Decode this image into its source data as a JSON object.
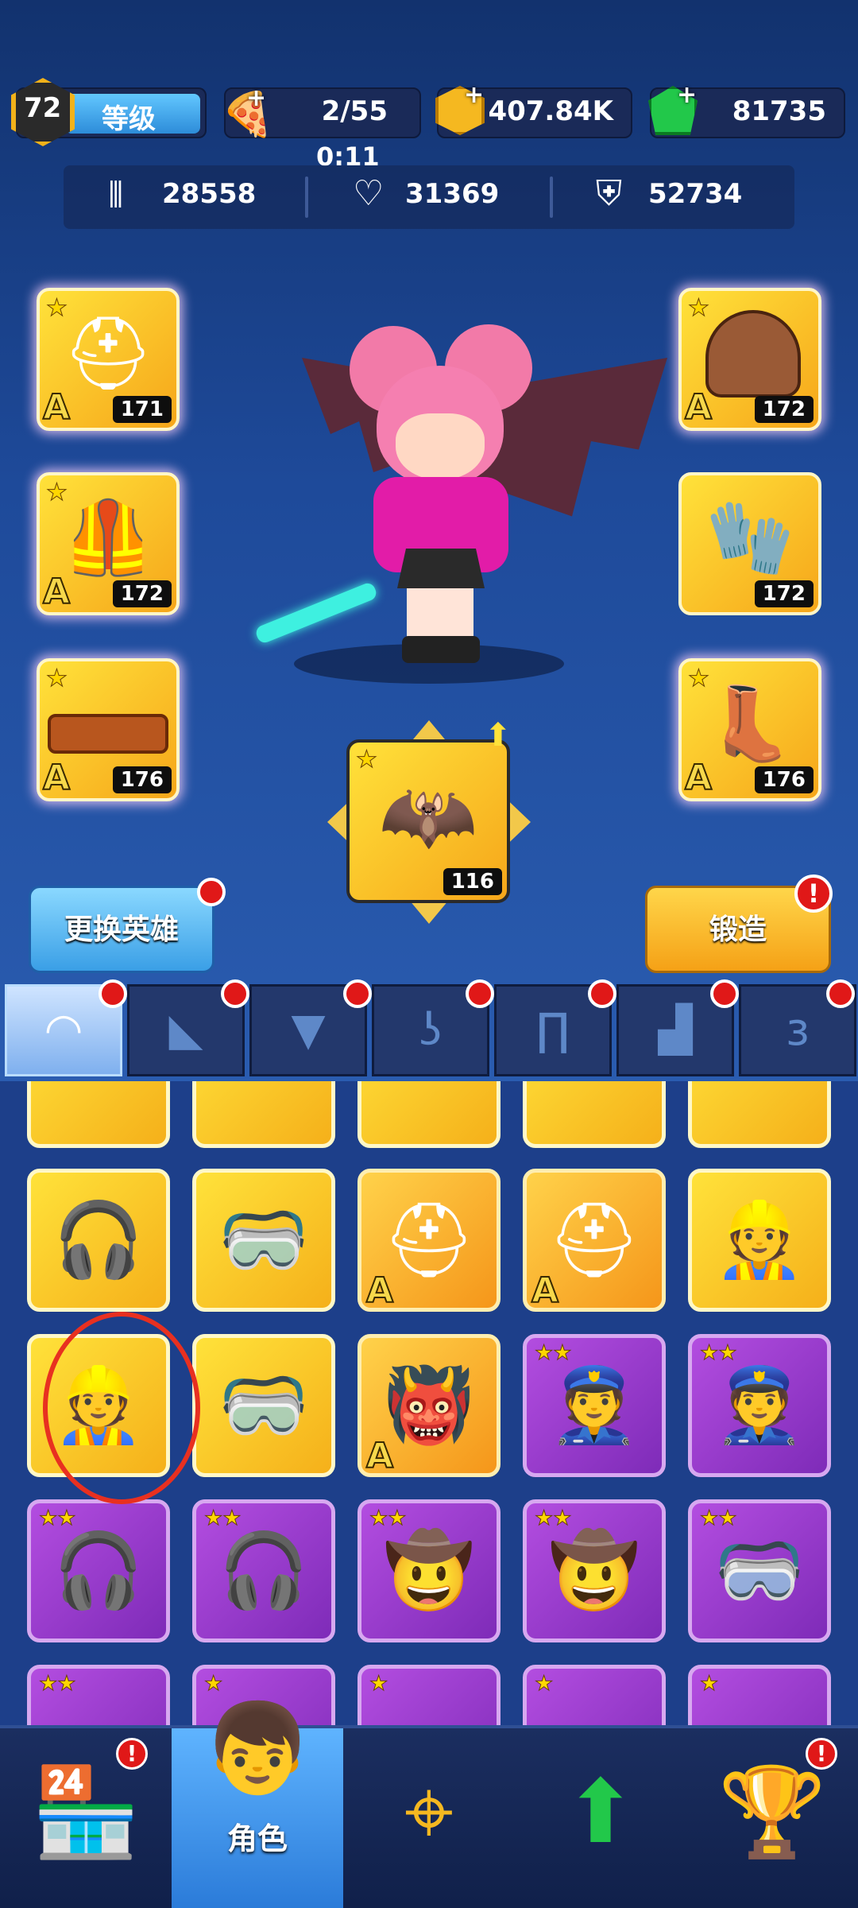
{
  "header": {
    "level": "72",
    "level_label": "等级",
    "pizza": "2/55",
    "timer": "0:11",
    "gold": "407.84K",
    "gems": "81735"
  },
  "stats": {
    "ammo": "28558",
    "health": "31369",
    "armor": "52734"
  },
  "equipped": [
    {
      "name": "helmet",
      "level": "171",
      "grade": "A",
      "icon": "⛑"
    },
    {
      "name": "vest",
      "level": "172",
      "grade": "A",
      "icon": "🦺"
    },
    {
      "name": "belt",
      "level": "176",
      "grade": "A",
      "icon": "➰"
    },
    {
      "name": "shoulder",
      "level": "172",
      "grade": "A",
      "icon": "🛡"
    },
    {
      "name": "glove",
      "level": "172",
      "grade": "",
      "icon": "🧤"
    },
    {
      "name": "boot",
      "level": "176",
      "grade": "A",
      "icon": "👢"
    }
  ],
  "wings": {
    "level": "116",
    "icon": "🦇"
  },
  "buttons": {
    "change_hero": "更换英雄",
    "forge": "锻造"
  },
  "tabs": [
    "cap-icon",
    "shoulder-icon",
    "shirt-icon",
    "glove-icon",
    "pants-icon",
    "boot-icon",
    "wing-icon"
  ],
  "inventory": [
    {
      "icon": "🎧",
      "color": "yellow",
      "grade": "",
      "stars": ""
    },
    {
      "icon": "🥽",
      "color": "yellow",
      "grade": "",
      "stars": ""
    },
    {
      "icon": "⛑",
      "color": "orange",
      "grade": "A",
      "stars": ""
    },
    {
      "icon": "⛑",
      "color": "orange",
      "grade": "A",
      "stars": ""
    },
    {
      "icon": "👷",
      "color": "yellow",
      "grade": "",
      "stars": ""
    },
    {
      "icon": "👷",
      "color": "yellow",
      "grade": "",
      "stars": ""
    },
    {
      "icon": "🥽",
      "color": "yellow",
      "grade": "",
      "stars": ""
    },
    {
      "icon": "👹",
      "color": "orange",
      "grade": "A",
      "stars": ""
    },
    {
      "icon": "👮",
      "color": "purple",
      "grade": "",
      "stars": "★★"
    },
    {
      "icon": "👮",
      "color": "purple",
      "grade": "",
      "stars": "★★"
    },
    {
      "icon": "🎧",
      "color": "purple",
      "grade": "",
      "stars": "★★"
    },
    {
      "icon": "🎧",
      "color": "purple",
      "grade": "",
      "stars": "★★"
    },
    {
      "icon": "🤠",
      "color": "purple",
      "grade": "",
      "stars": "★★"
    },
    {
      "icon": "🤠",
      "color": "purple",
      "grade": "",
      "stars": "★★"
    },
    {
      "icon": "🥽",
      "color": "purple",
      "grade": "",
      "stars": "★★"
    }
  ],
  "nav": {
    "role_label": "角色"
  }
}
